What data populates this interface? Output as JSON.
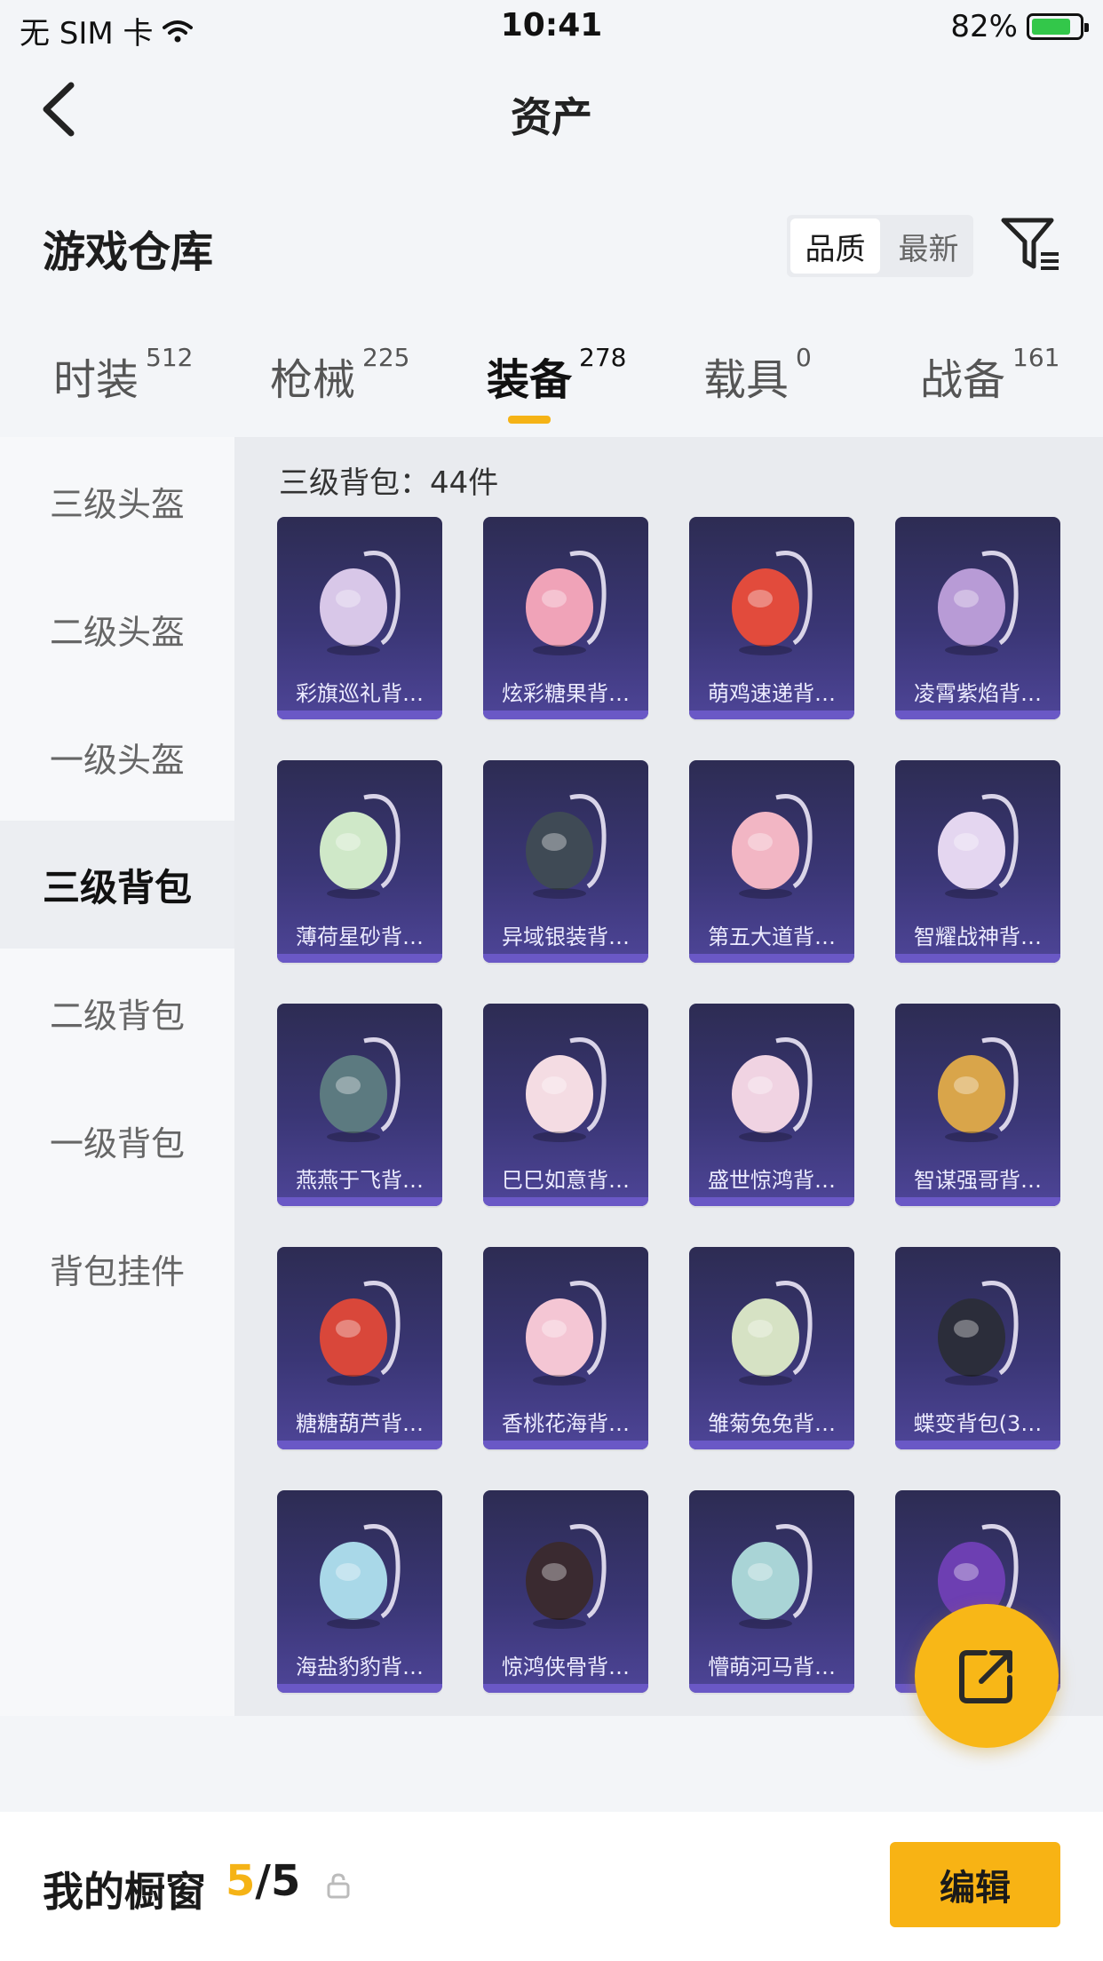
{
  "status_bar": {
    "carrier": "无 SIM 卡",
    "time": "10:41",
    "battery": "82%"
  },
  "nav": {
    "title": "资产"
  },
  "section": {
    "title": "游戏仓库"
  },
  "sort": {
    "options": [
      "品质",
      "最新"
    ],
    "selected": "品质"
  },
  "tabs": [
    {
      "label": "时装",
      "count": "512"
    },
    {
      "label": "枪械",
      "count": "225"
    },
    {
      "label": "装备",
      "count": "278"
    },
    {
      "label": "载具",
      "count": "0"
    },
    {
      "label": "战备",
      "count": "161"
    }
  ],
  "active_tab": "装备",
  "sidebar": {
    "items": [
      "三级头盔",
      "二级头盔",
      "一级头盔",
      "三级背包",
      "二级背包",
      "一级背包",
      "背包挂件"
    ],
    "active": "三级背包"
  },
  "content": {
    "subtitle": "三级背包：44件",
    "items": [
      {
        "name": "彩旗巡礼背…",
        "color": "#d8c7e8"
      },
      {
        "name": "炫彩糖果背…",
        "color": "#f0a3b8"
      },
      {
        "name": "萌鸡速递背…",
        "color": "#e24b3c"
      },
      {
        "name": "凌霄紫焰背…",
        "color": "#b89bd6"
      },
      {
        "name": "薄荷星砂背…",
        "color": "#cfe8c8"
      },
      {
        "name": "异域银装背…",
        "color": "#3f4a55"
      },
      {
        "name": "第五大道背…",
        "color": "#f2b6c4"
      },
      {
        "name": "智耀战神背…",
        "color": "#e4d6f0"
      },
      {
        "name": "燕燕于飞背…",
        "color": "#5c7a80"
      },
      {
        "name": "巳巳如意背…",
        "color": "#f4dce3"
      },
      {
        "name": "盛世惊鸿背…",
        "color": "#f0d3e2"
      },
      {
        "name": "智谋强哥背…",
        "color": "#d9a54a"
      },
      {
        "name": "糖糖葫芦背…",
        "color": "#d9473a"
      },
      {
        "name": "香桃花海背…",
        "color": "#f4c6d4"
      },
      {
        "name": "雏菊兔兔背…",
        "color": "#d6e2c4"
      },
      {
        "name": "蝶变背包(3…",
        "color": "#2b2d3a"
      },
      {
        "name": "海盐豹豹背…",
        "color": "#a9d8e8"
      },
      {
        "name": "惊鸿侠骨背…",
        "color": "#3a2a30"
      },
      {
        "name": "懵萌河马背…",
        "color": "#a9d4d6"
      },
      {
        "name": "",
        "color": "#6d3fb2"
      }
    ]
  },
  "showcase": {
    "title": "我的橱窗",
    "current": "5",
    "total": "/5"
  },
  "edit_button": "编辑"
}
